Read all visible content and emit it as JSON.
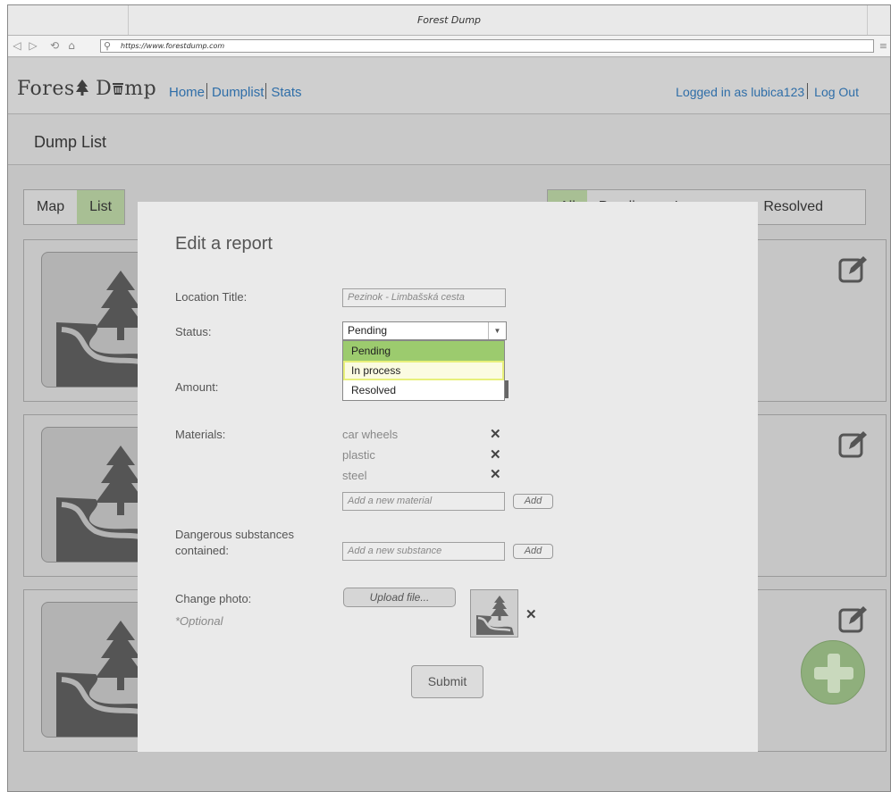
{
  "window": {
    "title": "Forest Dump"
  },
  "browser": {
    "url": "https://www.forestdump.com",
    "icons": [
      "back-icon",
      "forward-icon",
      "reload-icon",
      "home-icon",
      "search-icon",
      "menu-icon"
    ]
  },
  "header": {
    "logo": "Fores♣ D▦mp",
    "logo_text": "ForestDump",
    "nav": [
      {
        "label": "Home"
      },
      {
        "label": "Dumplist"
      },
      {
        "label": "Stats"
      }
    ],
    "logged_in_text": "Logged in as lubica123",
    "logout_label": "Log Out"
  },
  "page": {
    "title": "Dump List",
    "view_toggle": [
      {
        "label": "Map",
        "active": false
      },
      {
        "label": "List",
        "active": true
      }
    ],
    "filters": [
      {
        "label": "All",
        "active": true
      },
      {
        "label": "Pending",
        "active": false
      },
      {
        "label": "In process",
        "active": false
      },
      {
        "label": "Resolved",
        "active": false
      }
    ]
  },
  "modal": {
    "title": "Edit a report",
    "location_label": "Location Title:",
    "location_value": "Pezinok - Limbašská cesta",
    "status_label": "Status:",
    "status_selected": "Pending",
    "status_options": [
      "Pending",
      "In process",
      "Resolved"
    ],
    "amount_label": "Amount:",
    "materials_label": "Materials:",
    "materials": [
      "car wheels",
      "plastic",
      "steel"
    ],
    "material_placeholder": "Add a new material",
    "add_label": "Add",
    "dangerous_label_line1": "Dangerous substances",
    "dangerous_label_line2": "contained:",
    "substance_placeholder": "Add a new substance",
    "photo_label": "Change photo:",
    "optional_label": "*Optional",
    "upload_label": "Upload file...",
    "submit_label": "Submit"
  },
  "colors": {
    "accent_green": "#9ccb6e",
    "link_blue": "#2f6ea8",
    "fab_green": "#8faf7c",
    "hover_yellow": "#fbfbe1"
  }
}
